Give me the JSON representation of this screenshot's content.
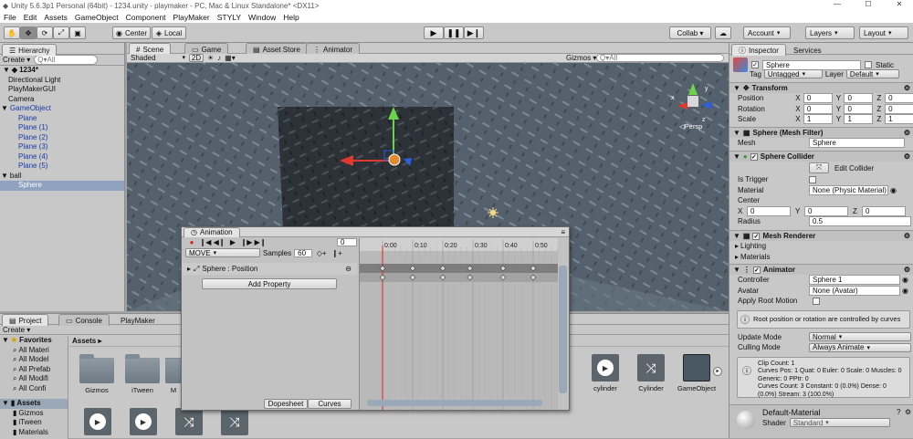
{
  "window": {
    "title": "Unity 5.6.3p1 Personal (64bit) - 1234.unity - playmaker - PC, Mac & Linux Standalone* <DX11>",
    "min": "—",
    "max": "☐",
    "close": "✕"
  },
  "menu": [
    "File",
    "Edit",
    "Assets",
    "GameObject",
    "Component",
    "PlayMaker",
    "STYLY",
    "Window",
    "Help"
  ],
  "toolbar": {
    "pivot": "Center",
    "space": "Local",
    "collab": "Collab ▾",
    "cloud": "☁",
    "account": "Account",
    "layers": "Layers",
    "layout": "Layout"
  },
  "hierarchy": {
    "tab": "Hierarchy",
    "create": "Create ▾",
    "search_placeholder": "Q▾All",
    "scene": "1234*",
    "items": [
      {
        "label": "Directional Light",
        "indent": 1
      },
      {
        "label": "PlayMakerGUI",
        "indent": 1
      },
      {
        "label": "Camera",
        "indent": 1
      },
      {
        "label": "GameObject",
        "indent": 1,
        "blue": true,
        "expand": "▼"
      },
      {
        "label": "Plane",
        "indent": 2,
        "blue": true
      },
      {
        "label": "Plane (1)",
        "indent": 2,
        "blue": true
      },
      {
        "label": "Plane (2)",
        "indent": 2,
        "blue": true
      },
      {
        "label": "Plane (3)",
        "indent": 2,
        "blue": true
      },
      {
        "label": "Plane (4)",
        "indent": 2,
        "blue": true
      },
      {
        "label": "Plane (5)",
        "indent": 2,
        "blue": true
      },
      {
        "label": "ball",
        "indent": 1,
        "expand": "▼"
      },
      {
        "label": "Sphere",
        "indent": 2,
        "selected": true
      }
    ]
  },
  "scene_tabs": [
    {
      "label": "Scene",
      "active": true
    },
    {
      "label": "Game"
    },
    {
      "label": "Asset Store"
    },
    {
      "label": "Animator"
    }
  ],
  "scene_toolbar": {
    "shading": "Shaded",
    "mode2d": "2D",
    "gizmos": "Gizmos ▾",
    "search_placeholder": "Q▾All"
  },
  "scene_gizmo": {
    "label": "◁Persp",
    "x": "x",
    "y": "y",
    "z": "z"
  },
  "inspector": {
    "tabs": [
      "Inspector",
      "Services"
    ],
    "object_name": "Sphere",
    "static": "Static",
    "tag_label": "Tag",
    "tag": "Untagged",
    "layer_label": "Layer",
    "layer": "Default",
    "transform": {
      "title": "Transform",
      "rows": [
        {
          "label": "Position",
          "x": "0",
          "y": "0",
          "z": "0"
        },
        {
          "label": "Rotation",
          "x": "0",
          "y": "0",
          "z": "0"
        },
        {
          "label": "Scale",
          "x": "1",
          "y": "1",
          "z": "1"
        }
      ]
    },
    "mesh_filter": {
      "title": "Sphere (Mesh Filter)",
      "mesh_label": "Mesh",
      "mesh": "Sphere"
    },
    "collider": {
      "title": "Sphere Collider",
      "edit": "Edit Collider",
      "trigger": "Is Trigger",
      "material_label": "Material",
      "material": "None (Physic Material)",
      "center": "Center",
      "cx": "0",
      "cy": "0",
      "cz": "0",
      "radius_label": "Radius",
      "radius": "0.5"
    },
    "renderer": {
      "title": "Mesh Renderer",
      "lighting": "Lighting",
      "materials": "Materials"
    },
    "animator": {
      "title": "Animator",
      "controller_label": "Controller",
      "controller": "Sphere 1",
      "avatar_label": "Avatar",
      "avatar": "None (Avatar)",
      "root_motion": "Apply Root Motion",
      "notice": "Root position or rotation are controlled by curves",
      "update_label": "Update Mode",
      "update": "Normal",
      "culling_label": "Culling Mode",
      "culling": "Always Animate",
      "stats": "Clip Count: 1\nCurves Pos: 1 Quat: 0 Euler: 0 Scale: 0 Muscles: 0 Generic: 0 PPtr: 0\nCurves Count: 3 Constant: 0 (0.0%) Dense: 0 (0.0%) Stream: 3 (100.0%)"
    },
    "material": {
      "name": "Default-Material",
      "shader_label": "Shader",
      "shader": "Standard"
    }
  },
  "project": {
    "tabs": [
      "Project",
      "Console",
      "PlayMaker"
    ],
    "create": "Create ▾",
    "favorites": "Favorites",
    "favorites_items": [
      "All Materi",
      "All Model",
      "All Prefab",
      "All Modifi",
      "All Confi"
    ],
    "assets_header": "Assets",
    "assets_breadcrumb": "Assets ▸",
    "assets_tree": [
      "Gizmos",
      "iTween",
      "Materials"
    ],
    "grid_items": [
      "Gizmos",
      "iTween",
      "M"
    ],
    "right_items": [
      "cylinder",
      "Cylinder",
      "GameObject"
    ]
  },
  "animation": {
    "tab": "Animation",
    "frame": "0",
    "clip": "MOVE",
    "samples_label": "Samples",
    "samples": "60",
    "ticks": [
      "0:00",
      "0:10",
      "0:20",
      "0:30",
      "0:40",
      "0:50"
    ],
    "property": "Sphere : Position",
    "add_property": "Add Property",
    "bottom_tabs": [
      "Dopesheet",
      "Curves"
    ]
  }
}
